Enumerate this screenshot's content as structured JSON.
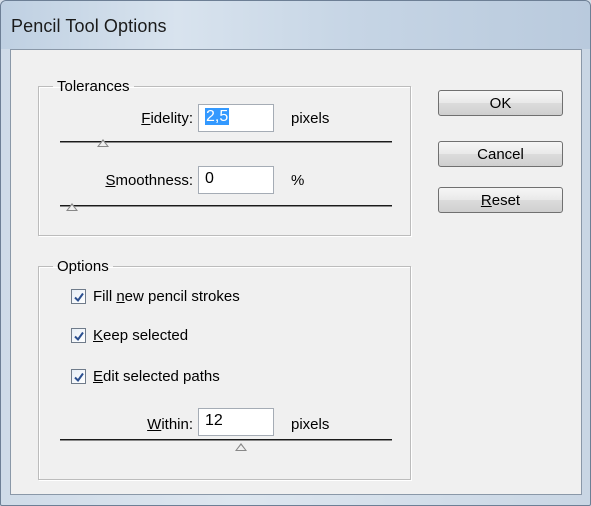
{
  "window": {
    "title": "Pencil Tool Options"
  },
  "tolerances": {
    "legend": "Tolerances",
    "fidelity": {
      "label_access": "F",
      "label_rest": "idelity:",
      "value": "2,5",
      "unit": "pixels",
      "slider_fraction": 0.1
    },
    "smoothness": {
      "label_access": "S",
      "label_rest": "moothness:",
      "value": "0",
      "unit": "%",
      "slider_fraction": 0.0
    }
  },
  "options": {
    "legend": "Options",
    "fill_new": {
      "pre": "Fill ",
      "access": "n",
      "post": "ew pencil strokes",
      "checked": true
    },
    "keep_selected": {
      "pre": "",
      "access": "K",
      "post": "eep selected",
      "checked": true
    },
    "edit_selected": {
      "pre": "",
      "access": "E",
      "post": "dit selected paths",
      "checked": true
    },
    "within": {
      "label_access": "W",
      "label_rest": "ithin:",
      "value": "12",
      "unit": "pixels",
      "slider_fraction": 0.55
    }
  },
  "buttons": {
    "ok": "OK",
    "cancel": "Cancel",
    "reset_access": "R",
    "reset_rest": "eset"
  }
}
